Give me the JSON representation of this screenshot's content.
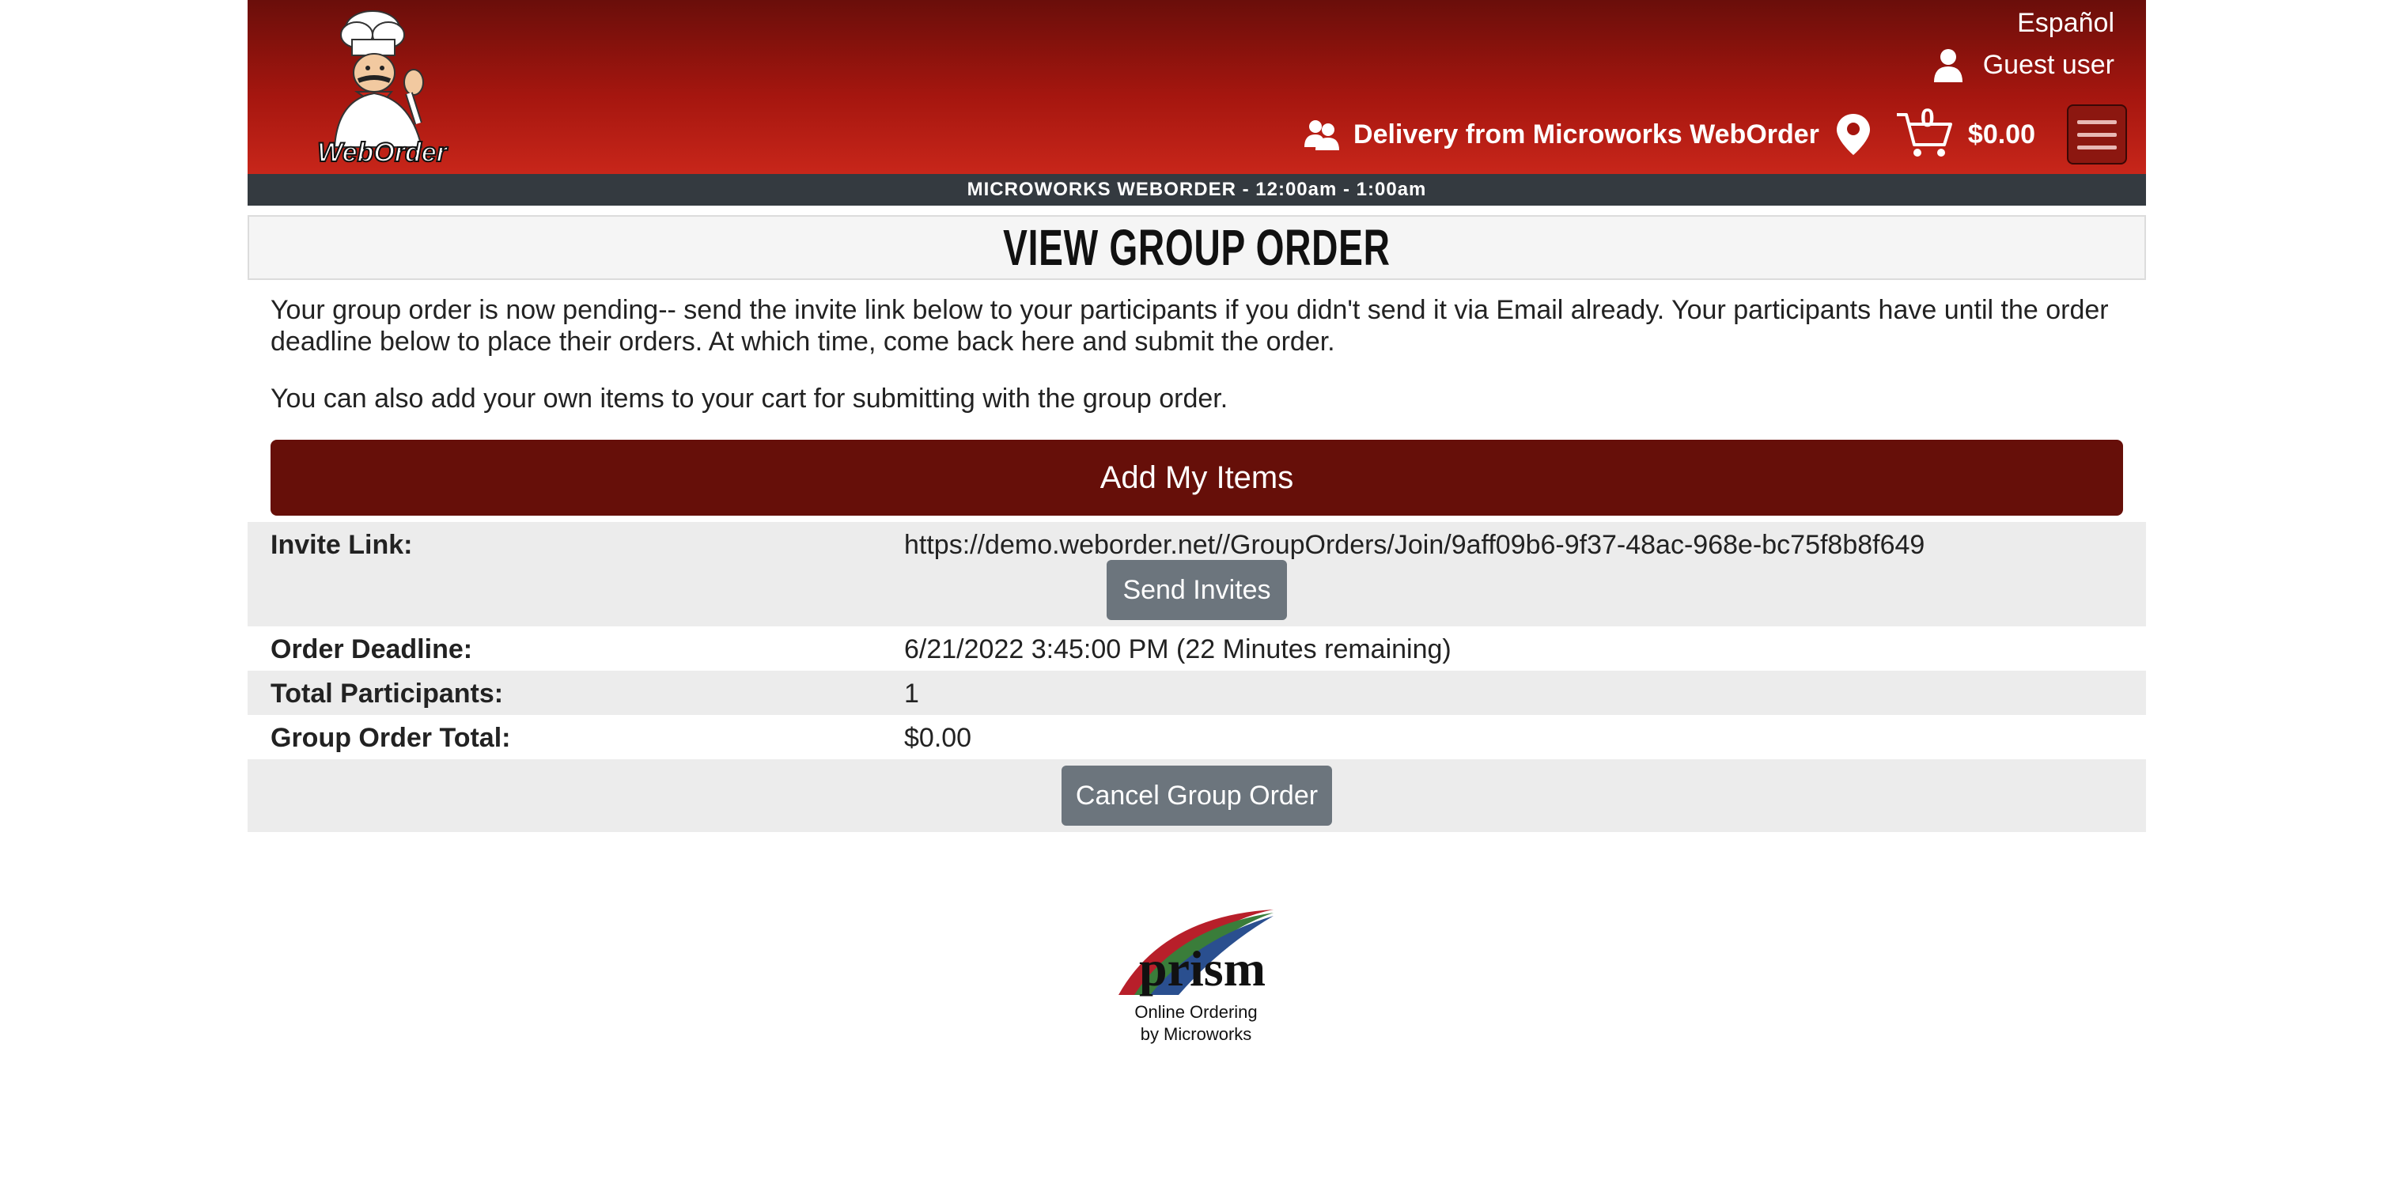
{
  "header": {
    "logo_text": "WebOrder",
    "language_link": "Español",
    "user_label": "Guest user",
    "delivery_label": "Delivery from Microworks WebOrder",
    "cart_count": "0",
    "cart_total": "$0.00",
    "hours_text": "MICROWORKS WEBORDER - 12:00am - 1:00am"
  },
  "main": {
    "title": "VIEW GROUP ORDER",
    "intro": "Your group order is now pending-- send the invite link below to your participants if you didn't send it via Email already. Your participants have until the order deadline below to place their orders. At which time, come back here and submit the order.",
    "note": "You can also add your own items to your cart for submitting with the group order.",
    "add_items_label": "Add My Items",
    "invite_label": "Invite Link:",
    "invite_link": "https://demo.weborder.net//GroupOrders/Join/9aff09b6-9f37-48ac-968e-bc75f8b8f649",
    "send_invites_label": "Send Invites",
    "deadline_label": "Order Deadline:",
    "deadline_value": "6/21/2022 3:45:00 PM (22 Minutes remaining)",
    "participants_label": "Total Participants:",
    "participants_value": "1",
    "total_label": "Group Order Total:",
    "total_value": "$0.00",
    "cancel_label": "Cancel Group Order"
  },
  "footer": {
    "logo_text": "prism",
    "line1": "Online Ordering",
    "line2": "by Microworks"
  }
}
